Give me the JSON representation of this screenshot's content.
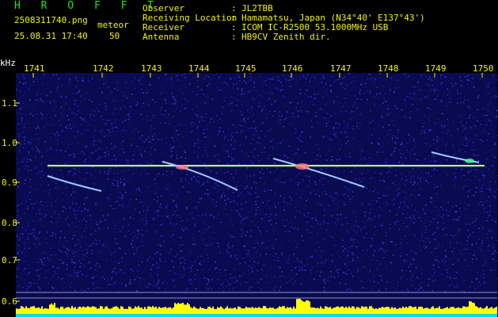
{
  "header": {
    "title": "H R O F F T",
    "file_name": "2508311740.png",
    "datetime": "25.08.31 17:40",
    "meteor_label": "meteor",
    "meteor_count": "50",
    "observer_label": "Observer",
    "observer_value": "JL2TBB",
    "location_label": "Receiving Location",
    "location_value": "Hamamatsu, Japan (N34°40' E137°43')",
    "receiver_label": "Receiver",
    "receiver_value": "ICOM IC-R2500 53.1000MHz USB",
    "antenna_label": "Antenna",
    "antenna_value": "HB9CV Zenith dir.",
    "separator": ":"
  },
  "axes": {
    "y_unit": "kHz",
    "x_ticks": [
      "1741",
      "1742",
      "1743",
      "1744",
      "1745",
      "1746",
      "1747",
      "1748",
      "1749",
      "1750"
    ],
    "y_ticks": [
      "1.1",
      "1.0",
      "0.9",
      "0.8",
      "0.7",
      "0.6"
    ]
  },
  "colors": {
    "background": "#000000",
    "noise": "#1a1a8a",
    "carrier": "#e8f060",
    "echo": "#a0c8ff",
    "label_yellow": "#f2f200",
    "label_green": "#22e022",
    "bar_yellow": "#ffff00",
    "bar_cyan": "#00d8ff"
  }
}
